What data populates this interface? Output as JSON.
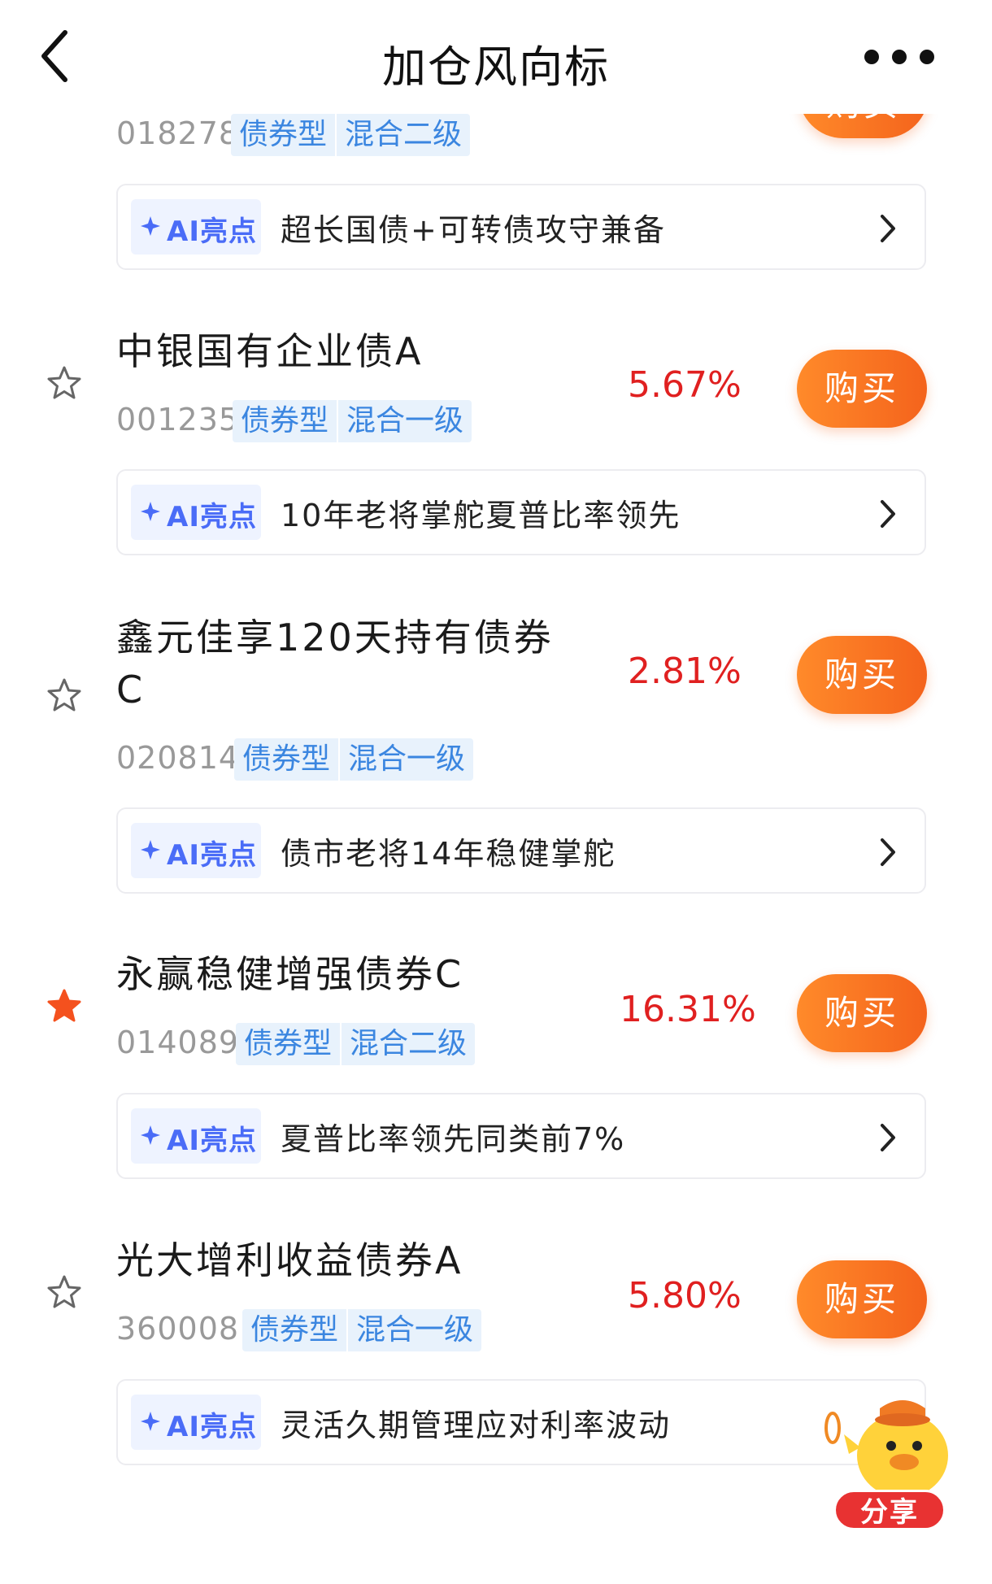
{
  "header": {
    "title": "加仓风向标"
  },
  "partial_item": {
    "code": "018278",
    "tags": [
      "债券型",
      "混合二级"
    ],
    "buy_label": "购买",
    "ai_badge": "AI亮点",
    "ai_text": "超长国债+可转债攻守兼备"
  },
  "funds": [
    {
      "name_line1": "中银国有企业债A",
      "name_line2": "",
      "code": "001235",
      "tags": [
        "债券型",
        "混合一级"
      ],
      "rate": "5.67%",
      "buy_label": "购买",
      "ai_badge": "AI亮点",
      "ai_text": "10年老将掌舵夏普比率领先",
      "starred": false
    },
    {
      "name_line1": "鑫元佳享120天持有债券",
      "name_line2": "C",
      "code": "020814",
      "tags": [
        "债券型",
        "混合一级"
      ],
      "rate": "2.81%",
      "buy_label": "购买",
      "ai_badge": "AI亮点",
      "ai_text": "债市老将14年稳健掌舵",
      "starred": false
    },
    {
      "name_line1": "永赢稳健增强债券C",
      "name_line2": "",
      "code": "014089",
      "tags": [
        "债券型",
        "混合二级"
      ],
      "rate": "16.31%",
      "buy_label": "购买",
      "ai_badge": "AI亮点",
      "ai_text": "夏普比率领先同类前7%",
      "starred": true
    },
    {
      "name_line1": "光大增利收益债券A",
      "name_line2": "",
      "code": "360008",
      "tags": [
        "债券型",
        "混合一级"
      ],
      "rate": "5.80%",
      "buy_label": "购买",
      "ai_badge": "AI亮点",
      "ai_text": "灵活久期管理应对利率波动",
      "starred": false
    }
  ],
  "share": {
    "label": "分享"
  },
  "colors": {
    "buy_gradient_start": "#ff8a2a",
    "buy_gradient_end": "#f4631c",
    "rate": "#e02020",
    "tag_text": "#3b86e0",
    "tag_bg": "#e8f2fc",
    "ai_accent": "#4a6cf7",
    "star_active": "#f4511e"
  }
}
